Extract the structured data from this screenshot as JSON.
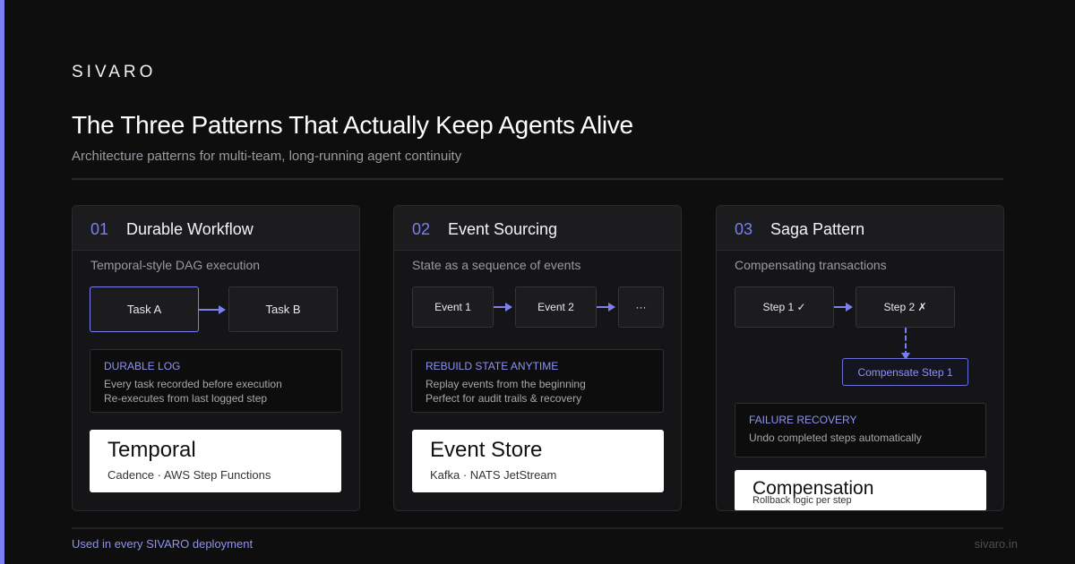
{
  "brand": "SIVARO",
  "title": "The Three Patterns That Actually Keep Agents Alive",
  "subtitle": "Architecture patterns for multi-team, long-running agent continuity",
  "colors": {
    "accent": "#7b7ff0",
    "background": "#0e0e0f",
    "card": "#151517"
  },
  "cards": [
    {
      "num": "01",
      "title": "Durable Workflow",
      "desc": "Temporal-style DAG execution",
      "nodes": [
        "Task A",
        "Task B"
      ],
      "info_title": "DURABLE LOG",
      "info_lines": [
        "Every task recorded before execution",
        "Re-executes from last logged step"
      ],
      "tool_name": "Temporal",
      "tool_sub": "Cadence · AWS Step Functions"
    },
    {
      "num": "02",
      "title": "Event Sourcing",
      "desc": "State as a sequence of events",
      "nodes": [
        "Event 1",
        "Event 2",
        "···"
      ],
      "info_title": "REBUILD STATE ANYTIME",
      "info_lines": [
        "Replay events from the beginning",
        "Perfect for audit trails & recovery"
      ],
      "tool_name": "Event Store",
      "tool_sub": "Kafka · NATS JetStream"
    },
    {
      "num": "03",
      "title": "Saga Pattern",
      "desc": "Compensating transactions",
      "nodes": [
        "Step 1 ✓",
        "Step 2 ✗",
        "Compensate Step 1"
      ],
      "info_title": "FAILURE RECOVERY",
      "info_lines": [
        "Undo completed steps automatically"
      ],
      "tool_name": "Compensation",
      "tool_sub": "Rollback logic per step"
    }
  ],
  "footer": {
    "left": "Used in every SIVARO deployment",
    "right": "sivaro.in"
  }
}
